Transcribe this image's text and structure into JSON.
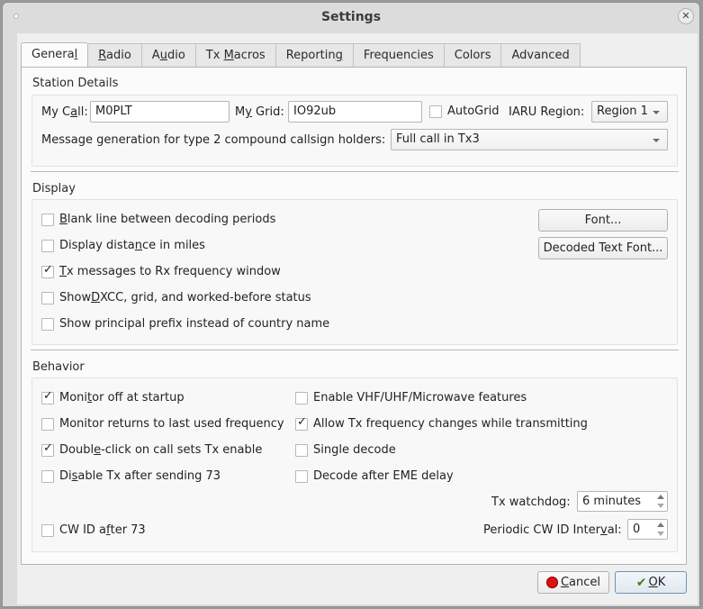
{
  "window": {
    "title": "Settings"
  },
  "tabs": [
    {
      "pre": "Genera",
      "u": "l",
      "post": "",
      "active": true
    },
    {
      "pre": "",
      "u": "R",
      "post": "adio"
    },
    {
      "pre": "A",
      "u": "u",
      "post": "dio"
    },
    {
      "pre": "Tx ",
      "u": "M",
      "post": "acros"
    },
    {
      "pre": "Reportin",
      "u": "g",
      "post": ""
    },
    {
      "pre": "Frequencies",
      "u": "",
      "post": ""
    },
    {
      "pre": "Colors",
      "u": "",
      "post": ""
    },
    {
      "pre": "Advanced",
      "u": "",
      "post": ""
    }
  ],
  "station": {
    "title": "Station Details",
    "my_call_label_pre": "My C",
    "my_call_label_u": "a",
    "my_call_label_post": "ll:",
    "my_call_value": "M0PLT",
    "my_grid_label_pre": "M",
    "my_grid_label_u": "y",
    "my_grid_label_post": " Grid:",
    "my_grid_value": "IO92ub",
    "autogrid_label": "AutoGrid",
    "autogrid_checked": false,
    "iaru_label": "IARU Region:",
    "iaru_value": "Region 1",
    "msggen_label": "Message generation for type 2 compound callsign holders:",
    "msggen_value": "Full call in Tx3"
  },
  "display": {
    "title": "Display",
    "options": [
      {
        "pre": "",
        "u": "B",
        "post": "lank line between decoding periods",
        "checked": false
      },
      {
        "pre": "Display dista",
        "u": "n",
        "post": "ce in miles",
        "checked": false
      },
      {
        "pre": "",
        "u": "T",
        "post": "x messages to Rx frequency window",
        "checked": true
      },
      {
        "pre": "Show ",
        "u": "D",
        "post": "XCC, grid, and worked-before status",
        "checked": false
      },
      {
        "pre": "Show principal prefix instead of country name",
        "u": "",
        "post": "",
        "checked": false
      }
    ],
    "font_button": "Font...",
    "decoded_font_button": "Decoded Text Font..."
  },
  "behavior": {
    "title": "Behavior",
    "left": [
      {
        "pre": "Moni",
        "u": "t",
        "post": "or off at startup",
        "checked": true
      },
      {
        "pre": "Monitor returns to last used frequency",
        "u": "",
        "post": "",
        "checked": false
      },
      {
        "pre": "Doubl",
        "u": "e",
        "post": "-click on call sets Tx enable",
        "checked": true
      },
      {
        "pre": "Di",
        "u": "s",
        "post": "able Tx after sending 73",
        "checked": false
      }
    ],
    "right": [
      {
        "pre": "Enable VHF/UHF/Microwave features",
        "u": "",
        "post": "",
        "checked": false
      },
      {
        "pre": "Allow Tx frequency changes while transmitting",
        "u": "",
        "post": "",
        "checked": true
      },
      {
        "pre": "Single decode",
        "u": "",
        "post": "",
        "checked": false
      },
      {
        "pre": "Decode after EME delay",
        "u": "",
        "post": "",
        "checked": false
      }
    ],
    "watchdog_label": "Tx watchdog:",
    "watchdog_value": "6 minutes",
    "cwid_after": {
      "pre": "CW ID a",
      "u": "f",
      "post": "ter 73",
      "checked": false
    },
    "cwid_interval_label_pre": "Periodic CW ID Inter",
    "cwid_interval_label_u": "v",
    "cwid_interval_label_post": "al:",
    "cwid_interval_value": "0"
  },
  "buttons": {
    "cancel_u": "C",
    "cancel_post": "ancel",
    "ok_u": "O",
    "ok_post": "K"
  }
}
